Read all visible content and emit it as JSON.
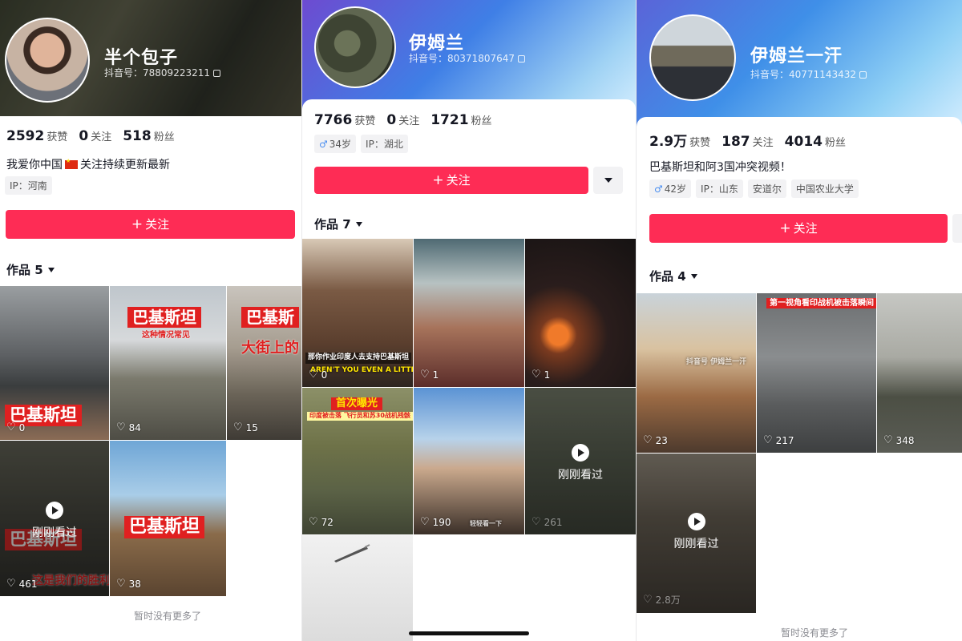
{
  "panels": [
    {
      "name": "半个包子",
      "id_label": "抖音号：",
      "id_value": "78809223211",
      "stats": [
        {
          "value": "2592",
          "label": "获赞"
        },
        {
          "value": "0",
          "label": "关注"
        },
        {
          "value": "518",
          "label": "粉丝"
        }
      ],
      "bio_before_flag": "我爱你中国",
      "bio_after_flag": "关注持续更新最新",
      "tags": [
        "IP：河南"
      ],
      "follow_label": "关注",
      "works_label": "作品",
      "works_count": "5",
      "videos": [
        {
          "likes": "0",
          "overlay": "巴基斯坦"
        },
        {
          "likes": "84",
          "overlay": "巴基斯坦",
          "sub": "这种情况常见"
        },
        {
          "likes": "15",
          "overlay": "巴基斯",
          "sub": "大街上的"
        },
        {
          "likes": "461",
          "overlay": "巴基斯坦",
          "sub": "这是我们的胜利",
          "watched": "刚刚看过"
        },
        {
          "likes": "38",
          "overlay": "巴基斯坦"
        }
      ],
      "no_more": "暂时没有更多了"
    },
    {
      "name": "伊姆兰",
      "id_label": "抖音号：",
      "id_value": "80371807647",
      "stats": [
        {
          "value": "7766",
          "label": "获赞"
        },
        {
          "value": "0",
          "label": "关注"
        },
        {
          "value": "1721",
          "label": "粉丝"
        }
      ],
      "gender_symbol": "♂",
      "tags": [
        "34岁",
        "IP：湖北"
      ],
      "follow_label": "关注",
      "works_label": "作品",
      "works_count": "7",
      "videos": [
        {
          "likes": "0",
          "top": "那你作业印度人去支持巴基斯坦",
          "bottom": "AREN'T YOU EVEN A LITTLE ASHAMED"
        },
        {
          "likes": "1"
        },
        {
          "likes": "1"
        },
        {
          "likes": "72",
          "top": "首次曝光",
          "sub": "印度被击落 飞行员和苏30战机残骸"
        },
        {
          "likes": "190",
          "sub": "轻轻看一下"
        },
        {
          "likes": "261",
          "watched": "刚刚看过"
        },
        {
          "likes": ""
        }
      ]
    },
    {
      "name": "伊姆兰一汗",
      "id_label": "抖音号：",
      "id_value": "40771143432",
      "stats": [
        {
          "value": "2.9万",
          "label": "获赞"
        },
        {
          "value": "187",
          "label": "关注"
        },
        {
          "value": "4014",
          "label": "粉丝"
        }
      ],
      "bio": "巴基斯坦和阿3国冲突视频！",
      "gender_symbol": "♂",
      "tags": [
        "42岁",
        "IP：山东",
        "安道尔",
        "中国农业大学"
      ],
      "follow_label": "关注",
      "works_label": "作品",
      "works_count": "4",
      "videos": [
        {
          "likes": "23",
          "watermark": "抖音号 伊姆兰一汗"
        },
        {
          "likes": "217",
          "top": "第一视角看印战机被击落瞬间"
        },
        {
          "likes": "348"
        },
        {
          "likes": "2.8万",
          "watched": "刚刚看过"
        }
      ],
      "no_more": "暂时没有更多了"
    }
  ]
}
